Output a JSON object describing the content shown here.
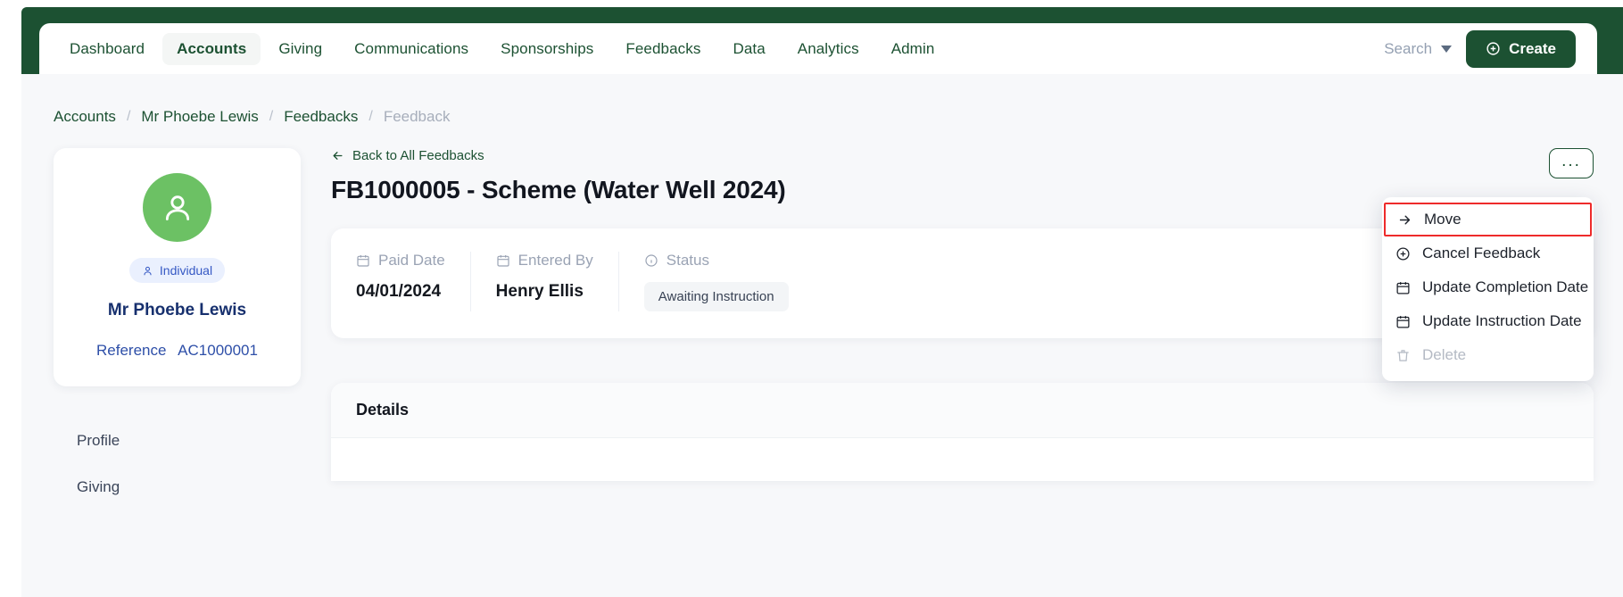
{
  "theme": {
    "brand_green": "#1c5132",
    "avatar_green": "#6cc164",
    "badge_blue": "#3558c4",
    "highlight_red": "#ee2b2b",
    "title_navy": "#17306e"
  },
  "nav": {
    "items": [
      {
        "label": "Dashboard",
        "active": false
      },
      {
        "label": "Accounts",
        "active": true
      },
      {
        "label": "Giving",
        "active": false
      },
      {
        "label": "Communications",
        "active": false
      },
      {
        "label": "Sponsorships",
        "active": false
      },
      {
        "label": "Feedbacks",
        "active": false
      },
      {
        "label": "Data",
        "active": false
      },
      {
        "label": "Analytics",
        "active": false
      },
      {
        "label": "Admin",
        "active": false
      }
    ],
    "search_label": "Search",
    "create_label": "Create"
  },
  "breadcrumb": {
    "items": [
      "Accounts",
      "Mr Phoebe Lewis",
      "Feedbacks",
      "Feedback"
    ],
    "separator": "/"
  },
  "profile": {
    "avatar_icon": "person-icon",
    "type_badge": "Individual",
    "name": "Mr Phoebe Lewis",
    "reference_label": "Reference",
    "reference_value": "AC1000001"
  },
  "side_nav": {
    "items": [
      "Profile",
      "Giving"
    ]
  },
  "feedback": {
    "back_link": "Back to All Feedbacks",
    "title": "FB1000005 - Scheme (Water Well 2024)",
    "kebab_label": "...",
    "fields": [
      {
        "label": "Paid Date",
        "icon": "calendar-icon",
        "value": "04/01/2024",
        "type": "text"
      },
      {
        "label": "Entered By",
        "icon": "calendar-icon",
        "value": "Henry Ellis",
        "type": "text"
      },
      {
        "label": "Status",
        "icon": "info-circle-icon",
        "value": "Awaiting Instruction",
        "type": "pill"
      }
    ],
    "details_heading": "Details"
  },
  "dropdown_menu": {
    "items": [
      {
        "label": "Move",
        "icon": "arrow-right-icon",
        "highlighted": true,
        "disabled": false
      },
      {
        "label": "Cancel Feedback",
        "icon": "plus-circle-icon",
        "highlighted": false,
        "disabled": false
      },
      {
        "label": "Update Completion Date",
        "icon": "calendar-icon",
        "highlighted": false,
        "disabled": false
      },
      {
        "label": "Update Instruction Date",
        "icon": "calendar-icon",
        "highlighted": false,
        "disabled": false
      },
      {
        "label": "Delete",
        "icon": "trash-icon",
        "highlighted": false,
        "disabled": true
      }
    ]
  }
}
